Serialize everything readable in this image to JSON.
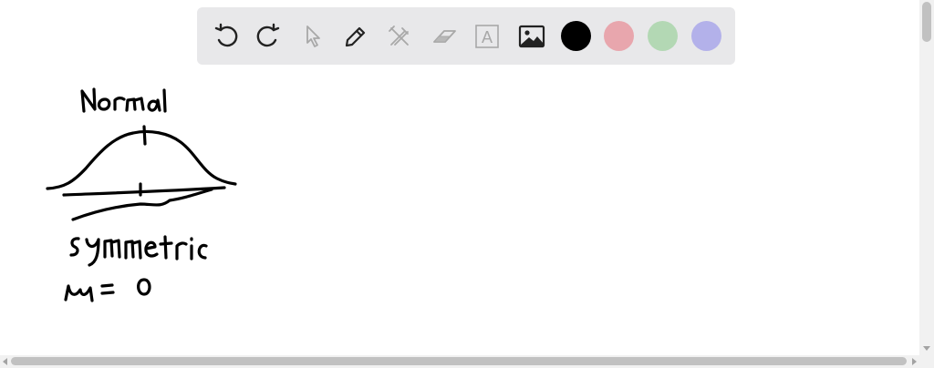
{
  "toolbar": {
    "tools": [
      {
        "icon": "undo-icon",
        "enabled": true
      },
      {
        "icon": "redo-icon",
        "enabled": true
      },
      {
        "icon": "select-pointer-icon",
        "enabled": false
      },
      {
        "icon": "pen-icon",
        "enabled": true
      },
      {
        "icon": "tools-icon",
        "enabled": false
      },
      {
        "icon": "eraser-icon",
        "enabled": false
      },
      {
        "icon": "text-box-icon",
        "enabled": false
      },
      {
        "icon": "image-icon",
        "enabled": true
      }
    ],
    "text_tool_glyph": "A",
    "colors": [
      {
        "name": "black",
        "hex": "#000000",
        "selected": true
      },
      {
        "name": "red",
        "hex": "#e8a6ad",
        "selected": false
      },
      {
        "name": "green",
        "hex": "#b3d8b4",
        "selected": false
      },
      {
        "name": "purple",
        "hex": "#b3b1ea",
        "selected": false
      }
    ],
    "icon_color": "#222222",
    "disabled_icon_color": "#a8a8a8"
  },
  "canvas": {
    "handwritten_notes": [
      "Normal",
      "symmetric",
      "μ = 0"
    ]
  }
}
